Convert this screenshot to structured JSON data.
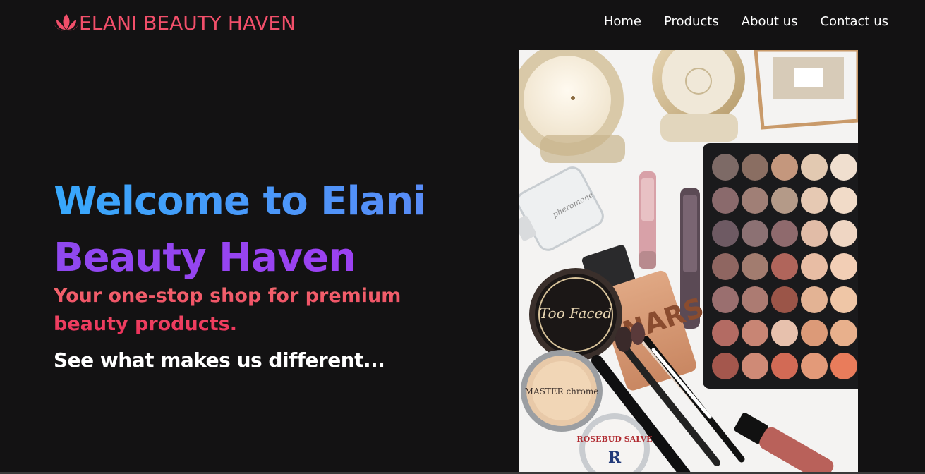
{
  "brand": {
    "name": "ELANI BEAUTY HAVEN",
    "icon": "lotus-icon",
    "color": "#f14f6a"
  },
  "nav": {
    "items": [
      {
        "label": "Home"
      },
      {
        "label": "Products"
      },
      {
        "label": "About us"
      },
      {
        "label": "Contact us"
      }
    ]
  },
  "hero": {
    "headline_line1": "Welcome to Elani",
    "headline_line2": "Beauty Haven",
    "tagline": "Your one-stop shop for premium beauty products.",
    "cta_text": "See what makes us different..."
  },
  "hero_image": {
    "subject": "makeup flat-lay with eyeshadow palette, candles, foundation and brushes",
    "product_labels": {
      "foundation": "NARS",
      "powder": "Too Faced",
      "highlighter": "MASTER chrome",
      "tin": "ROSEBUD SALVE",
      "tin_letter": "R",
      "bottle": "pheromone"
    }
  },
  "colors": {
    "background": "#131213",
    "headline_blue": "#37a8fc",
    "headline_purple": "#9a44f1",
    "tagline_red": "#ef4c63"
  }
}
